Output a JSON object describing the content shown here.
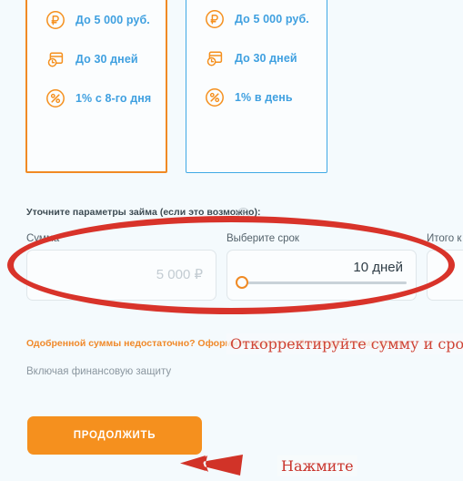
{
  "offer_cards": [
    {
      "name": "selected-offer-card",
      "state": "selected",
      "border_color": "#f08a24",
      "features": [
        {
          "icon": "ruble-circle-icon",
          "text": "До 5 000 руб."
        },
        {
          "icon": "calendar-clock-icon",
          "text": "До 30 дней"
        },
        {
          "icon": "percent-circle-icon",
          "text": "1% с 8-го дня"
        }
      ]
    },
    {
      "name": "alternate-offer-card",
      "state": "default",
      "border_color": "#3fa9e5",
      "features": [
        {
          "icon": "ruble-circle-icon",
          "text": "До 5 000 руб."
        },
        {
          "icon": "calendar-clock-icon",
          "text": "До 30 дней"
        },
        {
          "icon": "percent-circle-icon",
          "text": "1% в день"
        }
      ]
    }
  ],
  "params": {
    "section_label": "Уточните параметры займа (если это возможно):",
    "help_icon_glyph": "?",
    "amount": {
      "label": "Сумма",
      "value": "",
      "placeholder": "5 000 ₽"
    },
    "term": {
      "label": "Выберите срок",
      "value": "10 дней",
      "slider_position_percent": 0
    },
    "total": {
      "label": "Итого к в",
      "value": ""
    }
  },
  "upsell_link": "Одобренной суммы недостаточно? Оформите заявку на большую сумму денег",
  "protection_note": "Включая финансовую защиту",
  "continue_button": "ПРОДОЛЖИТЬ",
  "annotations": {
    "ellipse_color": "#d8332a",
    "callout_adjust": "Откорректируйте сумму и срок",
    "callout_press": "Нажмите",
    "arrow_color": "#d13328"
  }
}
